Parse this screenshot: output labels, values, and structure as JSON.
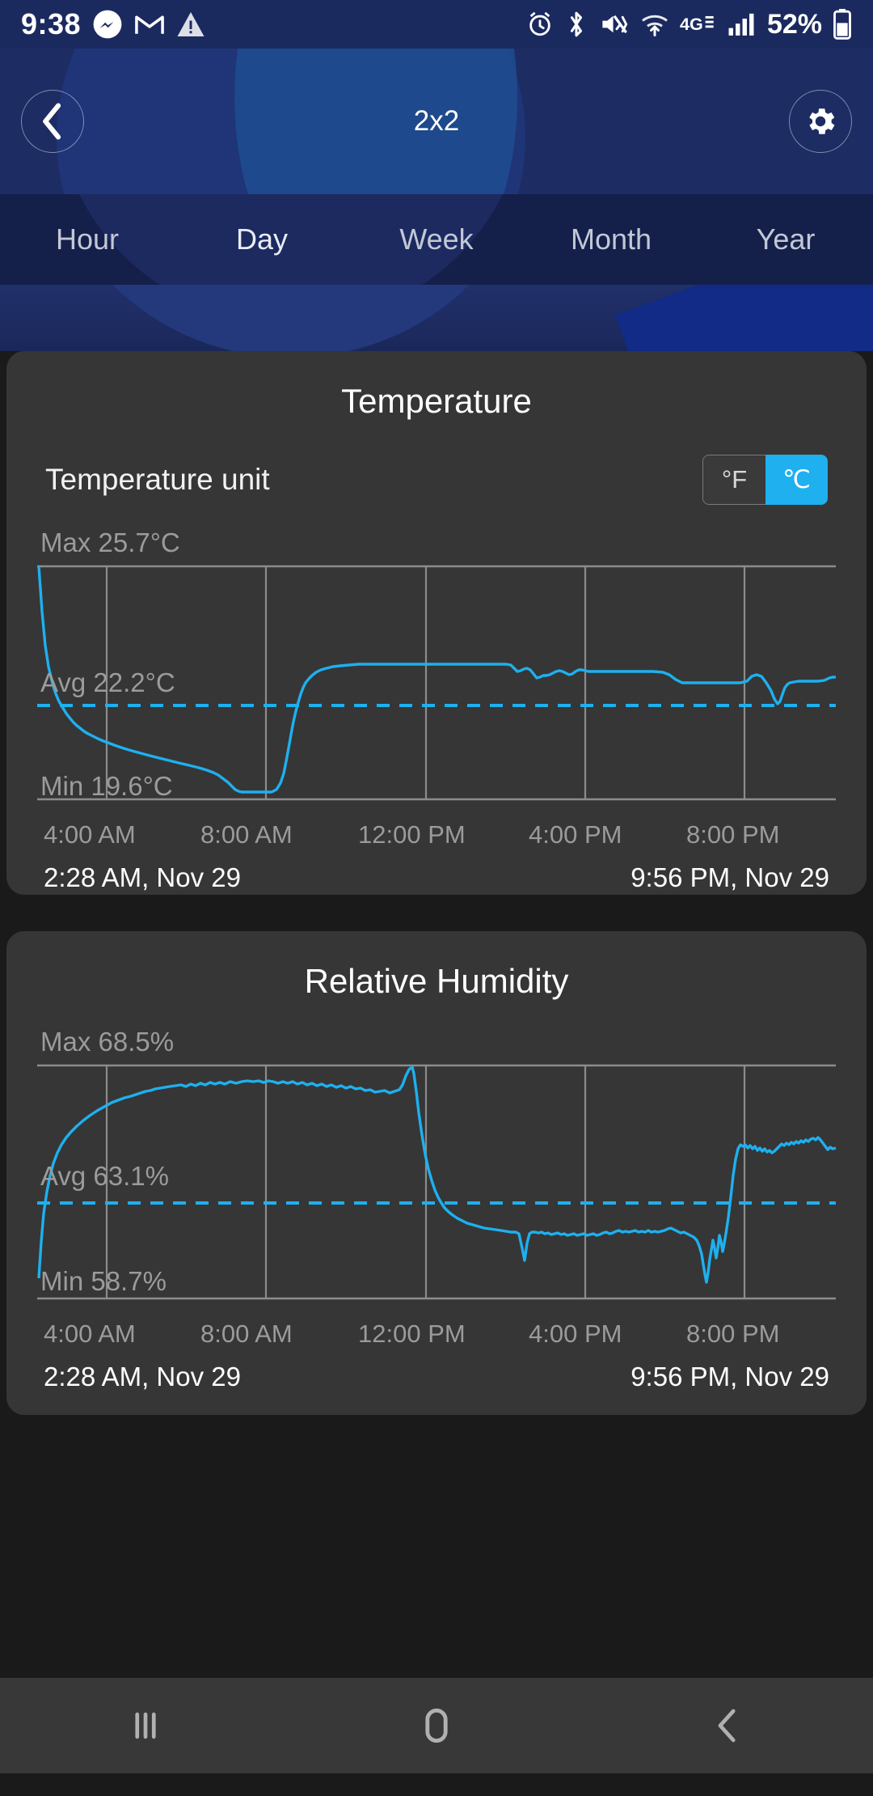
{
  "statusbar": {
    "time": "9:38",
    "battery": "52%",
    "network": "4G",
    "icons": [
      "messenger-icon",
      "gmail-icon",
      "warning-icon",
      "alarm-icon",
      "bluetooth-icon",
      "vibrate-icon",
      "wifi-icon",
      "signal-icon",
      "battery-icon"
    ]
  },
  "header": {
    "title": "2x2",
    "back_label": "‹",
    "settings_label": "settings"
  },
  "tabs": [
    {
      "label": "Hour",
      "active": false
    },
    {
      "label": "Day",
      "active": true
    },
    {
      "label": "Week",
      "active": false
    },
    {
      "label": "Month",
      "active": false
    },
    {
      "label": "Year",
      "active": false
    }
  ],
  "temperature_card": {
    "title": "Temperature",
    "unit_label": "Temperature unit",
    "unit_options": [
      "°F",
      "℃"
    ],
    "unit_selected": "℃",
    "max_label": "Max 25.7°C",
    "avg_label": "Avg 22.2°C",
    "min_label": "Min 19.6°C",
    "range_start": "2:28 AM,  Nov 29",
    "range_end": "9:56 PM,  Nov 29",
    "xticks": [
      "4:00 AM",
      "8:00 AM",
      "12:00 PM",
      "4:00 PM",
      "8:00 PM"
    ]
  },
  "humidity_card": {
    "title": "Relative Humidity",
    "max_label": "Max 68.5%",
    "avg_label": "Avg 63.1%",
    "min_label": "Min 58.7%",
    "range_start": "2:28 AM,  Nov 29",
    "range_end": "9:56 PM,  Nov 29",
    "xticks": [
      "4:00 AM",
      "8:00 AM",
      "12:00 PM",
      "4:00 PM",
      "8:00 PM"
    ]
  },
  "navbar": {
    "recents_label": "recents",
    "home_label": "home",
    "back_label": "back"
  },
  "colors": {
    "accent": "#1eb0ef",
    "card_bg": "#363636",
    "page_bg": "#1a1a1a",
    "header_bg": "#1d2c63",
    "tabbar_bg": "#141f4a",
    "grid": "#8c8c8c",
    "muted_text": "#9b9b9b"
  },
  "chart_data": [
    {
      "type": "line",
      "title": "Temperature",
      "ylabel": "°C",
      "xlabel": "",
      "unit": "°C",
      "max": 25.7,
      "avg": 22.2,
      "min": 19.6,
      "ylim": [
        19.6,
        25.7
      ],
      "grid": true,
      "legend": "none",
      "x_start": "2:28 AM, Nov 29",
      "x_end": "9:56 PM, Nov 29",
      "xticks": [
        "4:00 AM",
        "8:00 AM",
        "12:00 PM",
        "4:00 PM",
        "8:00 PM"
      ],
      "avg_line": 22.2,
      "x": [
        0,
        0.5,
        1,
        1.5,
        2,
        2.5,
        3,
        3.5,
        4,
        4.5,
        5,
        5.5,
        6,
        6.5,
        7,
        7.5,
        8,
        8.5,
        9,
        9.5,
        10,
        10.5,
        11,
        11.5,
        12,
        12.5,
        13,
        13.5,
        14,
        14.5,
        15,
        15.5,
        16,
        16.5,
        17,
        17.5,
        18,
        18.5,
        19,
        19.5,
        20,
        20.5,
        21,
        21.5,
        22,
        22.5,
        23,
        23.5,
        24,
        25,
        26,
        27,
        28,
        29,
        30,
        31,
        32,
        33,
        34,
        35,
        36,
        37,
        38,
        39,
        40
      ],
      "values": [
        25.7,
        24.5,
        23.6,
        23.0,
        22.6,
        22.3,
        22.1,
        21.9,
        21.75,
        21.6,
        21.45,
        21.3,
        21.2,
        21.1,
        21.0,
        20.9,
        20.8,
        20.7,
        20.6,
        20.5,
        20.42,
        20.35,
        20.28,
        20.2,
        20.1,
        20.0,
        19.95,
        19.9,
        19.85,
        19.8,
        19.75,
        19.7,
        19.65,
        19.6,
        19.6,
        20.6,
        21.9,
        22.55,
        22.85,
        22.95,
        23.0,
        23.0,
        23.0,
        23.0,
        23.0,
        23.0,
        22.95,
        22.9,
        22.85,
        22.9,
        22.85,
        22.8,
        22.75,
        22.7,
        22.65,
        22.6,
        22.5,
        22.4,
        22.35,
        22.3,
        22.5,
        22.45,
        21.9,
        22.35,
        22.4
      ]
    },
    {
      "type": "line",
      "title": "Relative Humidity",
      "ylabel": "%",
      "xlabel": "",
      "unit": "%",
      "max": 68.5,
      "avg": 63.1,
      "min": 58.7,
      "ylim": [
        58.7,
        68.5
      ],
      "grid": true,
      "legend": "none",
      "x_start": "2:28 AM, Nov 29",
      "x_end": "9:56 PM, Nov 29",
      "xticks": [
        "4:00 AM",
        "8:00 AM",
        "12:00 PM",
        "4:00 PM",
        "8:00 PM"
      ],
      "avg_line": 63.1,
      "x": [
        0,
        0.4,
        0.8,
        1.2,
        1.6,
        2,
        2.5,
        3,
        3.5,
        4,
        4.5,
        5,
        5.5,
        6,
        6.5,
        7,
        7.5,
        8,
        8.2,
        8.5,
        9,
        9.5,
        10,
        10.5,
        11,
        11.5,
        12,
        12.5,
        13,
        13.5,
        14,
        14.5,
        15,
        15.5,
        16,
        16.5,
        17,
        17.5,
        18,
        18.5,
        19,
        19.5,
        20,
        20.3,
        20.6,
        21,
        21.5,
        22,
        22.5,
        23,
        23.5,
        24
      ],
      "values": [
        59.1,
        62.5,
        64.8,
        66.3,
        67.1,
        67.5,
        67.8,
        68.0,
        68.1,
        68.2,
        68.2,
        68.1,
        68.0,
        67.9,
        67.8,
        67.7,
        67.6,
        68.5,
        66.0,
        64.5,
        63.0,
        62.0,
        61.3,
        60.8,
        60.5,
        60.3,
        60.2,
        60.1,
        60.1,
        60.0,
        60.1,
        60.0,
        60.1,
        60.0,
        60.1,
        60.0,
        60.1,
        60.2,
        60.1,
        60.0,
        59.9,
        58.7,
        61.0,
        60.6,
        61.5,
        61.3,
        61.4,
        61.5,
        61.6,
        61.8,
        61.9,
        61.7
      ]
    }
  ]
}
